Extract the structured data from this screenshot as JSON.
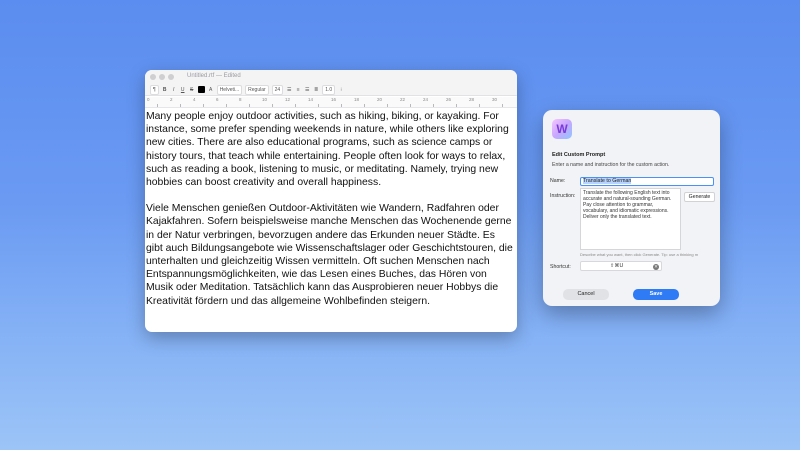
{
  "textedit": {
    "title": "Untitled.rtf",
    "status": "— Edited",
    "toolbar": {
      "paragraph_style": "¶",
      "bold": "B",
      "italic": "I",
      "underline": "U",
      "strikethrough": "S",
      "text_color": "#000000",
      "font_family": "Helveti...",
      "font_style": "Regular",
      "font_size": "24",
      "line_spacing": "1.0"
    },
    "ruler_numbers": [
      "0",
      "2",
      "4",
      "6",
      "8",
      "10",
      "12",
      "14",
      "16",
      "18",
      "20",
      "22",
      "24",
      "26",
      "28",
      "30"
    ],
    "paragraphs": [
      "Many people enjoy outdoor activities, such as hiking, biking, or kayaking. For instance, some prefer spending weekends in nature, while others like exploring new cities. There are also educational programs, such as science camps or history tours, that teach while entertaining. People often look for ways to relax, such as reading a book, listening to music, or meditating. Namely, trying new hobbies can boost creativity and overall happiness.",
      "Viele Menschen genießen Outdoor-Aktivitäten wie Wandern, Radfahren oder Kajakfahren. Sofern beispielsweise manche Menschen das Wochenende gerne in der Natur verbringen, bevorzugen andere das Erkunden neuer Städte. Es gibt auch Bildungsangebote wie Wissenschaftslager oder Geschichtstouren, die unterhalten und gleichzeitig Wissen vermitteln. Oft suchen Menschen nach Entspannungsmöglichkeiten, wie das Lesen eines Buches, das Hören von Musik oder Meditation. Tatsächlich kann das Ausprobieren neuer Hobbys die Kreativität fördern und das allgemeine Wohlbefinden steigern."
    ]
  },
  "dialog": {
    "app_icon_letter": "W",
    "heading": "Edit Custom Prompt",
    "subtitle": "Enter a name and instruction for the custom action.",
    "name_label": "Name:",
    "name_value": "Translate to German",
    "instruction_label": "Instruction:",
    "instruction_value": "Translate the following English text into accurate and natural-sounding German. Pay close attention to grammar, vocabulary, and idiomatic expressions. Deliver only the translated text.",
    "generate_label": "Generate",
    "hint": "Describe what you want, then click Generate. Tip: use a thinking m",
    "shortcut_label": "Shortcut:",
    "shortcut_value": "⇧⌘U",
    "clear_icon": "✕",
    "cancel_label": "Cancel",
    "save_label": "Save"
  },
  "colors": {
    "accent": "#2f7bf6",
    "desktop_top": "#5b8df0",
    "desktop_bottom": "#9cc4f7"
  }
}
